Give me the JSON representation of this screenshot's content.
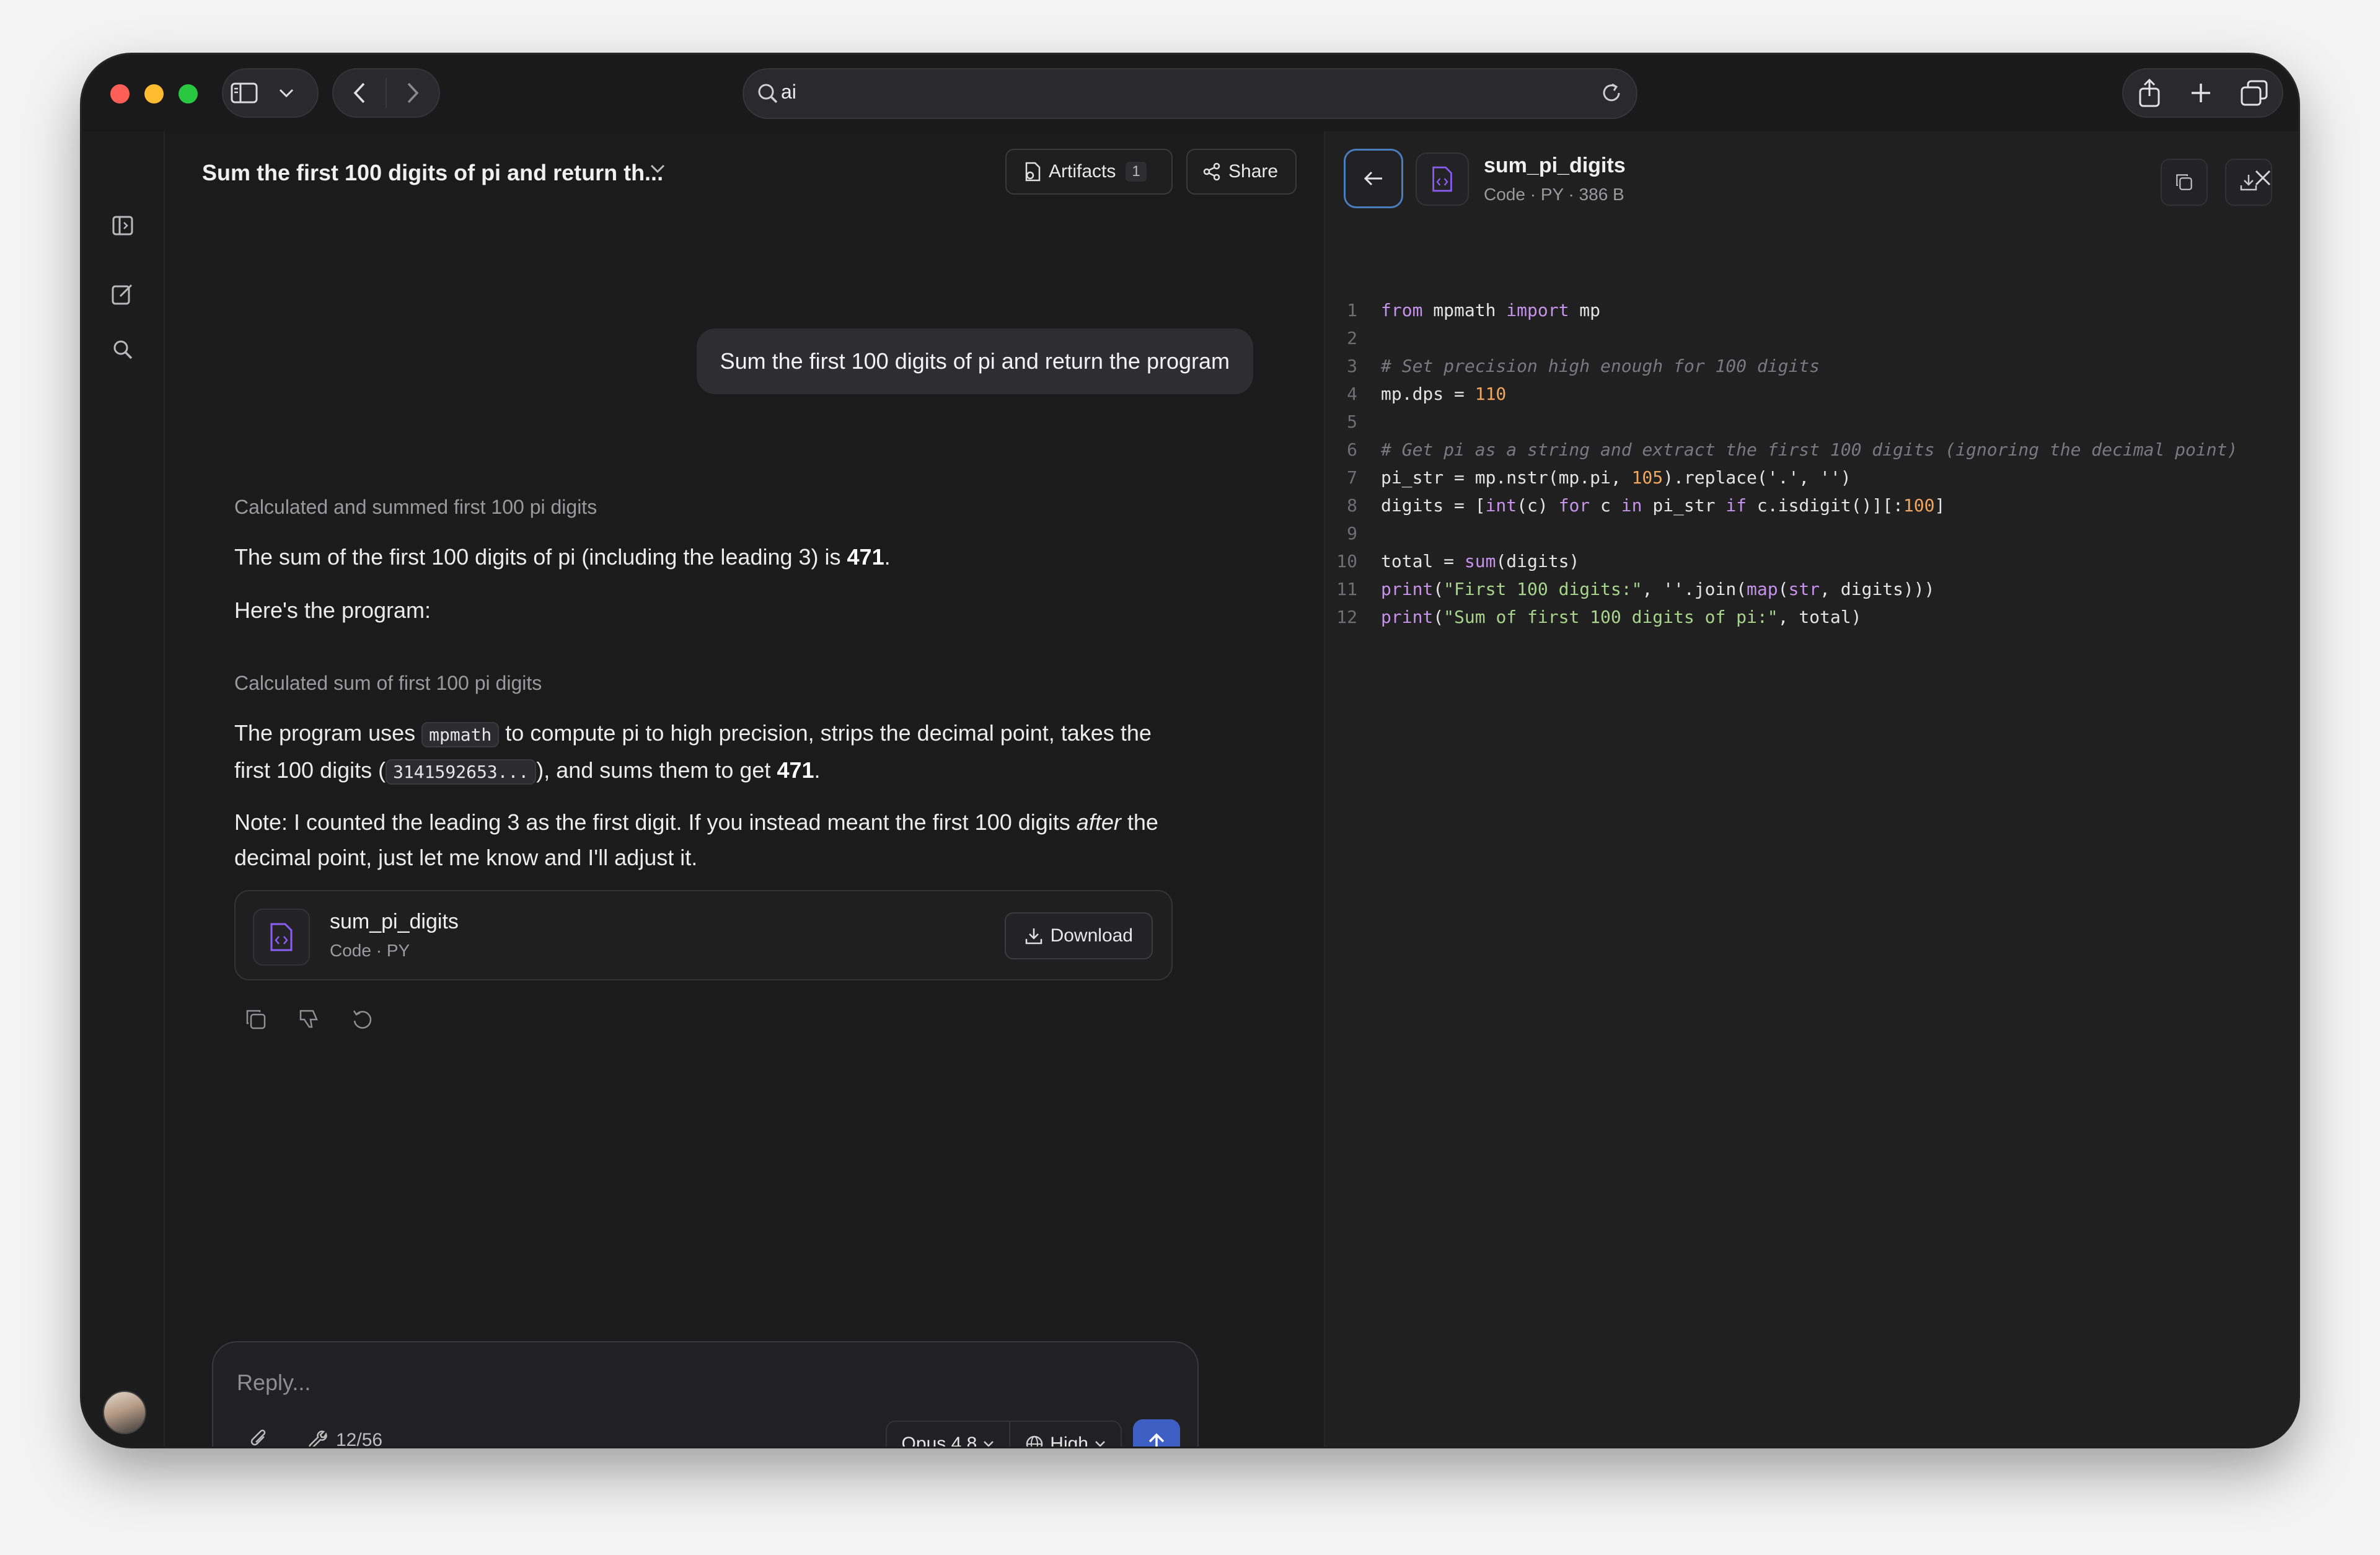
{
  "browser": {
    "address_value": "ai"
  },
  "chat": {
    "title": "Sum the first 100 digits of pi and return th...",
    "artifacts_label": "Artifacts",
    "artifacts_count": "1",
    "share_label": "Share",
    "user_message": "Sum the first 100 digits of pi and return the program",
    "thought_1": "Calculated and summed first 100 pi digits",
    "para_1_prefix": "The sum of the first 100 digits of pi (including the leading 3) is ",
    "para_1_bold": "471",
    "para_1_suffix": ".",
    "para_2": "Here's the program:",
    "thought_2": "Calculated sum of first 100 pi digits",
    "para_3_a": "The program uses ",
    "para_3_code": "mpmath",
    "para_3_b": " to compute pi to high precision, strips the decimal point, takes the first 100 digits (",
    "para_3_code2": "3141592653...",
    "para_3_c": "), and sums them to get ",
    "para_3_bold": "471",
    "para_3_d": ".",
    "para_4_a": "Note: I counted the leading 3 as the first digit. If you instead meant the first 100 digits ",
    "para_4_italic": "after",
    "para_4_b": " the decimal point, just let me know and I'll adjust it.",
    "file_card": {
      "name": "sum_pi_digits",
      "meta": "Code · PY",
      "download_label": "Download"
    }
  },
  "composer": {
    "placeholder": "Reply...",
    "tools_count": "12/56",
    "model": "Opus 4.8",
    "effort": "High"
  },
  "panel": {
    "file_name": "sum_pi_digits",
    "file_meta": "Code · PY · 386 B",
    "code_lines": [
      {
        "n": "1"
      },
      {
        "n": "2"
      },
      {
        "n": "3"
      },
      {
        "n": "4"
      },
      {
        "n": "5"
      },
      {
        "n": "6"
      },
      {
        "n": "7"
      },
      {
        "n": "8"
      },
      {
        "n": "9"
      },
      {
        "n": "10"
      },
      {
        "n": "11"
      },
      {
        "n": "12"
      }
    ],
    "code_text": {
      "l1_from": "from",
      "l1_mod": " mpmath ",
      "l1_import": "import",
      "l1_rest": " mp",
      "l3": "# Set precision high enough for 100 digits",
      "l4_a": "mp.dps = ",
      "l4_num": "110",
      "l6": "# Get pi as a string and extract the first 100 digits (ignoring the decimal point)",
      "l7_a": "pi_str = mp.nstr(mp.pi, ",
      "l7_num": "105",
      "l7_b": ").replace('.', '')",
      "l8_a": "digits = [",
      "l8_int": "int",
      "l8_b": "(c) ",
      "l8_for": "for",
      "l8_c": " c ",
      "l8_in": "in",
      "l8_d": " pi_str ",
      "l8_if": "if",
      "l8_e": " c.isdigit()][:",
      "l8_num": "100",
      "l8_f": "]",
      "l10_a": "total = ",
      "l10_sum": "sum",
      "l10_b": "(digits)",
      "l11_print": "print",
      "l11_a": "(",
      "l11_str": "\"First 100 digits:\"",
      "l11_b": ", ''.join(",
      "l11_map": "map",
      "l11_c": "(",
      "l11_strf": "str",
      "l11_d": ", digits)))",
      "l12_print": "print",
      "l12_a": "(",
      "l12_str": "\"Sum of first 100 digits of pi:\"",
      "l12_b": ", total)"
    }
  },
  "colors": {
    "accent_blue": "#3d5fc4",
    "file_icon_purple": "#8b5cf6"
  }
}
